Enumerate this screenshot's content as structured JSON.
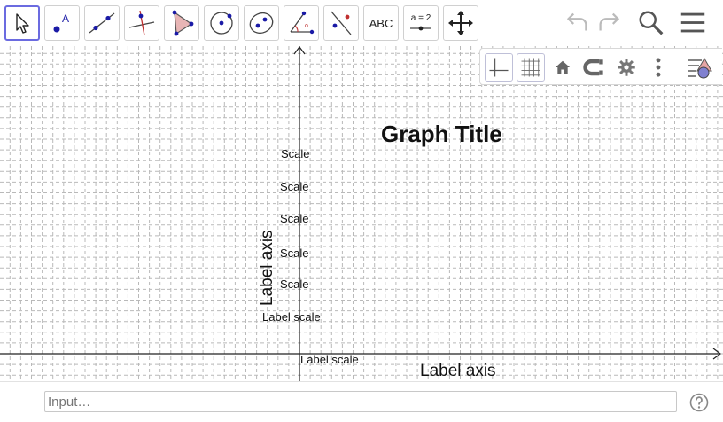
{
  "toolbar": {
    "tools": [
      {
        "id": "move",
        "icon": "move-pointer-icon"
      },
      {
        "id": "point",
        "icon": "point-icon"
      },
      {
        "id": "line",
        "icon": "line-through-points-icon"
      },
      {
        "id": "perpendicular",
        "icon": "perpendicular-line-icon"
      },
      {
        "id": "polygon",
        "icon": "polygon-icon"
      },
      {
        "id": "circle",
        "icon": "circle-center-point-icon"
      },
      {
        "id": "conic",
        "icon": "ellipse-icon"
      },
      {
        "id": "angle",
        "icon": "angle-icon"
      },
      {
        "id": "reflect",
        "icon": "reflect-about-line-icon"
      },
      {
        "id": "text",
        "label": "ABC"
      },
      {
        "id": "slider",
        "label": "a = 2"
      },
      {
        "id": "move-view",
        "icon": "move-graphics-view-icon"
      }
    ],
    "right": [
      "undo-icon",
      "redo-icon",
      "search-icon",
      "menu-icon"
    ]
  },
  "stylebar": [
    "axes-toggle-icon",
    "grid-toggle-icon",
    "home-icon",
    "point-capturing-icon",
    "settings-gear-icon",
    "more-vertical-icon",
    "graphics-style-icon"
  ],
  "graphics": {
    "title": "Graph Title",
    "y_axis_label": "Label axis",
    "x_axis_label": "Label axis",
    "scale_labels": [
      "Scale",
      "Scale",
      "Scale",
      "Scale",
      "Scale"
    ],
    "y_label_scale": "Label scale",
    "x_label_scale": "Label scale"
  },
  "input": {
    "placeholder": "Input…"
  }
}
